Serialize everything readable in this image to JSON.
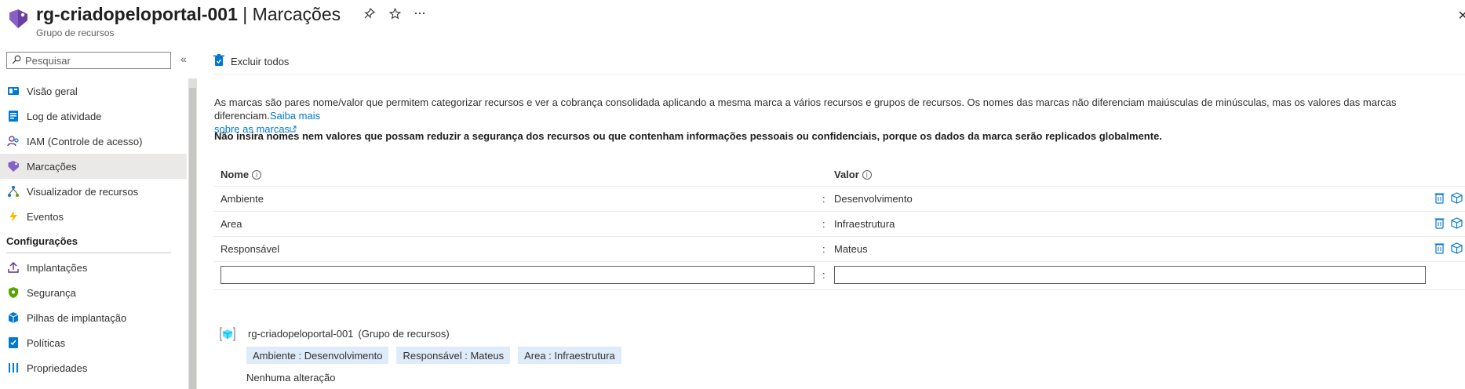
{
  "header": {
    "resource_name": "rg-criadopeloportal-001",
    "separator": "|",
    "page_name": "Marcações",
    "subtitle": "Grupo de recursos",
    "icons": [
      "pin-icon",
      "star-icon",
      "more-icon",
      "close-icon"
    ]
  },
  "sidebar": {
    "search_placeholder": "Pesquisar",
    "items": [
      {
        "label": "Visão geral",
        "icon": "overview-icon"
      },
      {
        "label": "Log de atividade",
        "icon": "activity-log-icon"
      },
      {
        "label": "IAM (Controle de acesso)",
        "icon": "iam-icon"
      },
      {
        "label": "Marcações",
        "icon": "tag-icon",
        "active": true
      },
      {
        "label": "Visualizador de recursos",
        "icon": "resource-visualizer-icon"
      },
      {
        "label": "Eventos",
        "icon": "events-icon"
      }
    ],
    "section_title": "Configurações",
    "settings_items": [
      {
        "label": "Implantações",
        "icon": "deployments-icon"
      },
      {
        "label": "Segurança",
        "icon": "security-icon"
      },
      {
        "label": "Pilhas de implantação",
        "icon": "deployment-stacks-icon"
      },
      {
        "label": "Políticas",
        "icon": "policies-icon"
      },
      {
        "label": "Propriedades",
        "icon": "properties-icon"
      }
    ]
  },
  "toolbar": {
    "delete_all_label": "Excluir todos"
  },
  "content": {
    "description": "As marcas são pares nome/valor que permitem categorizar recursos e ver a cobrança consolidada aplicando a mesma marca a vários recursos e grupos de recursos. Os nomes das marcas não diferenciam maiúsculas de minúsculas, mas os valores das marcas diferenciam.",
    "learn_more_line1": "Saiba mais",
    "learn_more_line2": "sobre as marcas",
    "warning": "Não insira nomes nem valores que possam reduzir a segurança dos recursos ou que contenham informações pessoais ou confidenciais, porque os dados da marca serão replicados globalmente."
  },
  "table": {
    "col_name": "Nome",
    "col_value": "Valor",
    "separator": ":",
    "rows": [
      {
        "name": "Ambiente",
        "value": "Desenvolvimento"
      },
      {
        "name": "Area",
        "value": "Infraestrutura"
      },
      {
        "name": "Responsável",
        "value": "Mateus"
      }
    ],
    "new_name": "",
    "new_value": ""
  },
  "summary": {
    "resource_name": "rg-criadopeloportal-001",
    "resource_type": "(Grupo de recursos)",
    "chips": [
      "Ambiente : Desenvolvimento",
      "Responsável : Mateus",
      "Area : Infraestrutura"
    ],
    "status": "Nenhuma alteração"
  },
  "colors": {
    "accent": "#0078d4",
    "tag_purple": "#8661c5",
    "chip_bg": "#deecf9",
    "active_nav_bg": "#ebe9e7"
  }
}
